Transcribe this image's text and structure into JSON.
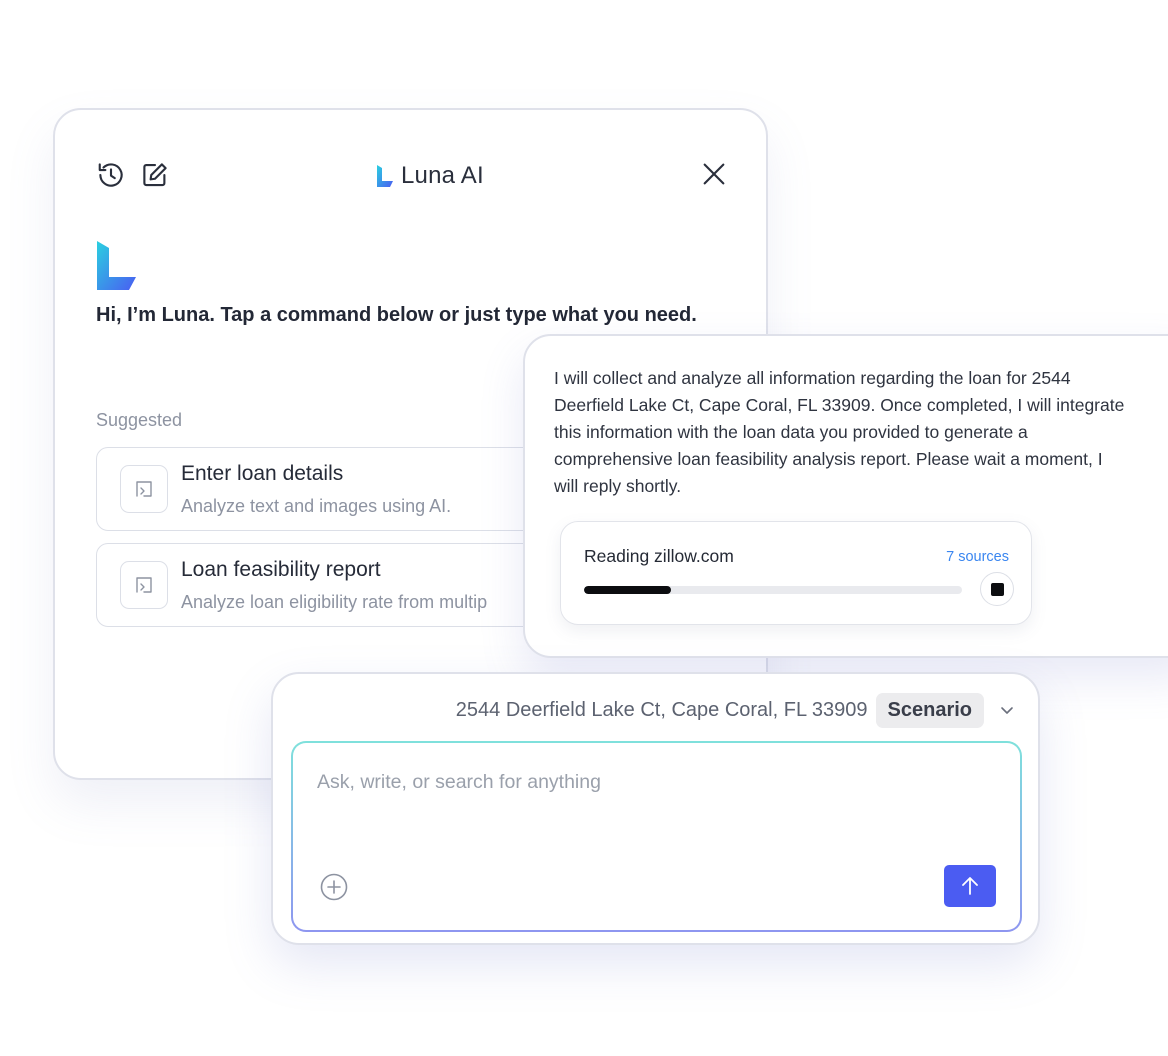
{
  "main_panel": {
    "title": "Luna AI",
    "greeting": "Hi, I’m Luna. Tap a command below or just type what you need.",
    "suggested_label": "Suggested",
    "suggestions": [
      {
        "title": "Enter loan details",
        "description": "Analyze text and images using AI."
      },
      {
        "title": "Loan feasibility report",
        "description": "Analyze loan eligibility rate from multip"
      }
    ]
  },
  "response": {
    "text": "I will collect and analyze all information regarding the loan for 2544\nDeerfield Lake Ct, Cape Coral, FL 33909. Once completed, I will integrate\nthis information with the loan data you provided to generate a\ncomprehensive loan feasibility analysis report. Please wait a moment, I\nwill reply shortly.",
    "reading_label": "Reading zillow.com",
    "sources_label": "7 sources",
    "progress_fraction": 0.23
  },
  "composer": {
    "address": "2544 Deerfield Lake Ct, Cape Coral, FL 33909",
    "scenario_label": "Scenario",
    "placeholder": "Ask, write, or search for anything"
  },
  "colors": {
    "accent": "#4b5cf2",
    "link": "#3a86f0",
    "logo_gradient_start": "#2ad0e0",
    "logo_gradient_end": "#4a5cf2"
  },
  "icons": [
    "history-icon",
    "edit-icon",
    "close-icon",
    "luna-logo-icon",
    "command-icon",
    "stop-icon",
    "chevron-down-icon",
    "plus-circle-icon",
    "arrow-up-icon"
  ]
}
